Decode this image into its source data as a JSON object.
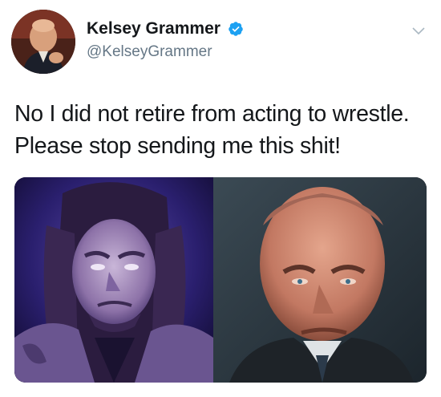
{
  "tweet": {
    "author": {
      "display_name": "Kelsey Grammer",
      "handle": "@KelseyGrammer",
      "verified": true
    },
    "text_lines": [
      "No I did not retire from acting to wrestle.",
      "Please stop sending me this shit!"
    ],
    "icons": {
      "verified": "verified-badge-icon",
      "menu": "chevron-down-icon"
    },
    "colors": {
      "verified_blue": "#1da1f2",
      "handle_gray": "#657786",
      "text": "#14171a"
    }
  }
}
